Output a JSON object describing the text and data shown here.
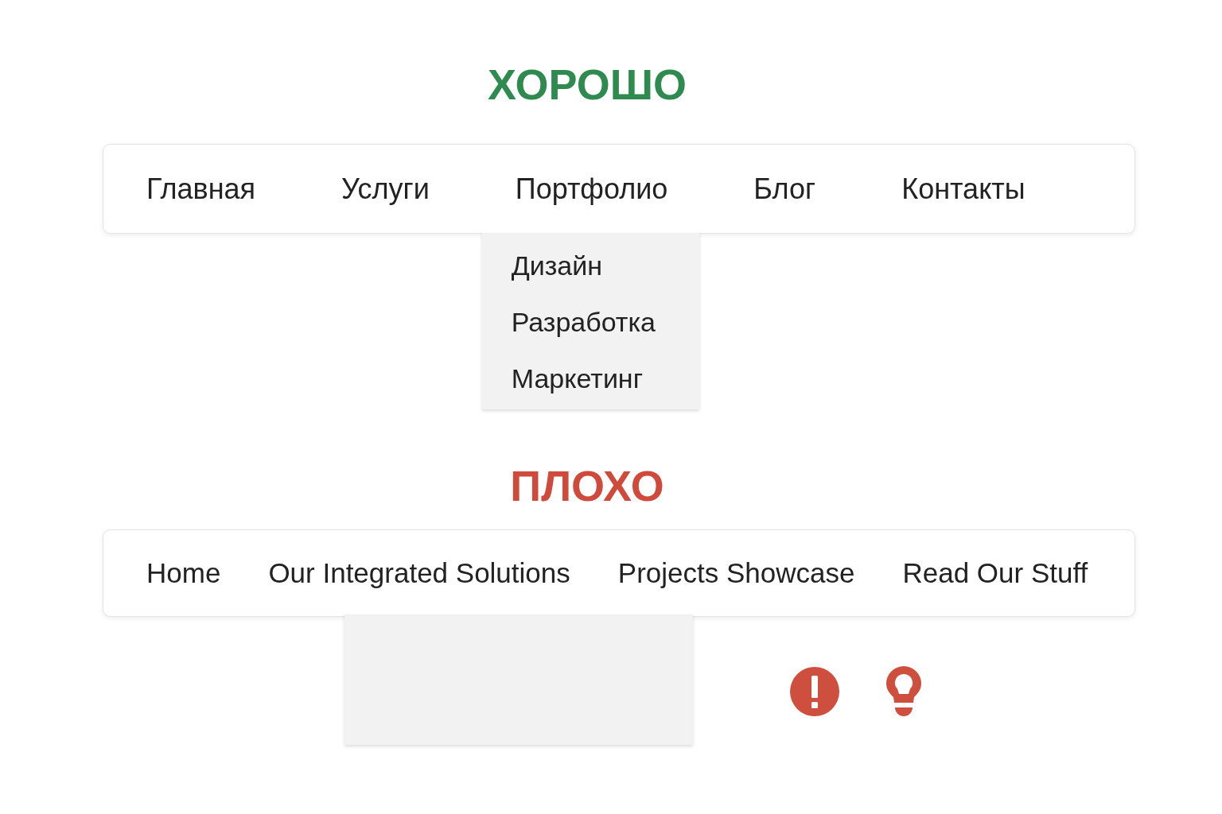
{
  "sections": [
    {
      "kind": "good",
      "heading": "ХОРОШО",
      "nav": {
        "items": [
          {
            "label": "Главная",
            "expanded": false
          },
          {
            "label": "Услуги",
            "expanded": false
          },
          {
            "label": "Портфолио",
            "expanded": true,
            "dropdown": [
              "Дизайн",
              "Разработка",
              "Маркетинг"
            ]
          },
          {
            "label": "Блог",
            "expanded": false
          },
          {
            "label": "Контакты",
            "expanded": false
          }
        ]
      }
    },
    {
      "kind": "bad",
      "heading": "ПЛОХО",
      "nav": {
        "items": [
          {
            "label": "Home",
            "expanded": false
          },
          {
            "label": "Our Integrated Solutions",
            "expanded": true
          },
          {
            "label": "Projects Showcase",
            "expanded": false
          },
          {
            "label": "Read Our Stuff",
            "expanded": false
          }
        ]
      }
    }
  ]
}
